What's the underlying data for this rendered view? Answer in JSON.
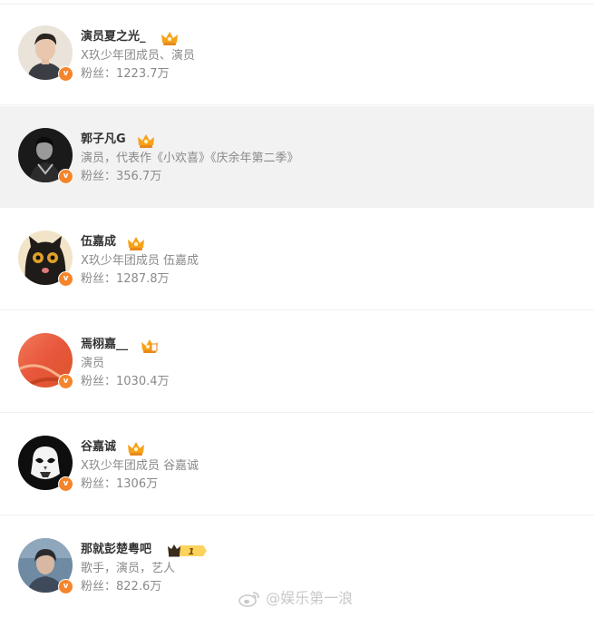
{
  "accounts": [
    {
      "name": "演员夏之光_",
      "desc": "X玖少年团成员、演员",
      "fans": "粉丝：1223.7万",
      "badge": "crown"
    },
    {
      "name": "郭子凡G",
      "desc": "演员，代表作《小欢喜》《庆余年第二季》",
      "fans": "粉丝：356.7万",
      "badge": "crown"
    },
    {
      "name": "伍嘉成",
      "desc": "X玖少年团成员 伍嘉成",
      "fans": "粉丝：1287.8万",
      "badge": "crown"
    },
    {
      "name": "焉栩嘉__",
      "desc": "演员",
      "fans": "粉丝：1030.4万",
      "badge": "crown-flag"
    },
    {
      "name": "谷嘉诚",
      "desc": "X玖少年团成员 谷嘉诚",
      "fans": "粉丝：1306万",
      "badge": "crown"
    },
    {
      "name": "那就彭楚粤吧",
      "desc": "歌手，演员，艺人",
      "fans": "粉丝：822.6万",
      "badge": "level",
      "level": "1"
    }
  ],
  "verified_mark": "v",
  "watermark": "@娱乐第一浪",
  "colors": {
    "verified": "#f5842a",
    "crown": "#f7a21b",
    "highlight_row": "#f2f2f2"
  }
}
